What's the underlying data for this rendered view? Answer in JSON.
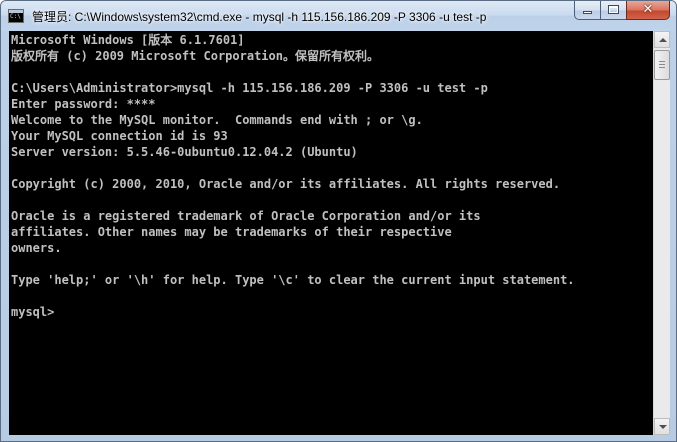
{
  "window": {
    "title": "管理员: C:\\Windows\\system32\\cmd.exe - mysql  -h 115.156.186.209 -P 3306 -u test -p"
  },
  "caption_buttons": {
    "minimize_icon": "minimize-icon",
    "maximize_icon": "maximize-icon",
    "close_icon": "close-icon",
    "close_glyph": "✕"
  },
  "console": {
    "colors": {
      "background": "#000000",
      "foreground": "#c0c0c0"
    },
    "lines": [
      "Microsoft Windows [版本 6.1.7601]",
      "版权所有 (c) 2009 Microsoft Corporation。保留所有权利。",
      "",
      "C:\\Users\\Administrator>mysql -h 115.156.186.209 -P 3306 -u test -p",
      "Enter password: ****",
      "Welcome to the MySQL monitor.  Commands end with ; or \\g.",
      "Your MySQL connection id is 93",
      "Server version: 5.5.46-0ubuntu0.12.04.2 (Ubuntu)",
      "",
      "Copyright (c) 2000, 2010, Oracle and/or its affiliates. All rights reserved.",
      "",
      "Oracle is a registered trademark of Oracle Corporation and/or its",
      "affiliates. Other names may be trademarks of their respective",
      "owners.",
      "",
      "Type 'help;' or '\\h' for help. Type '\\c' to clear the current input statement.",
      "",
      "mysql>"
    ]
  }
}
